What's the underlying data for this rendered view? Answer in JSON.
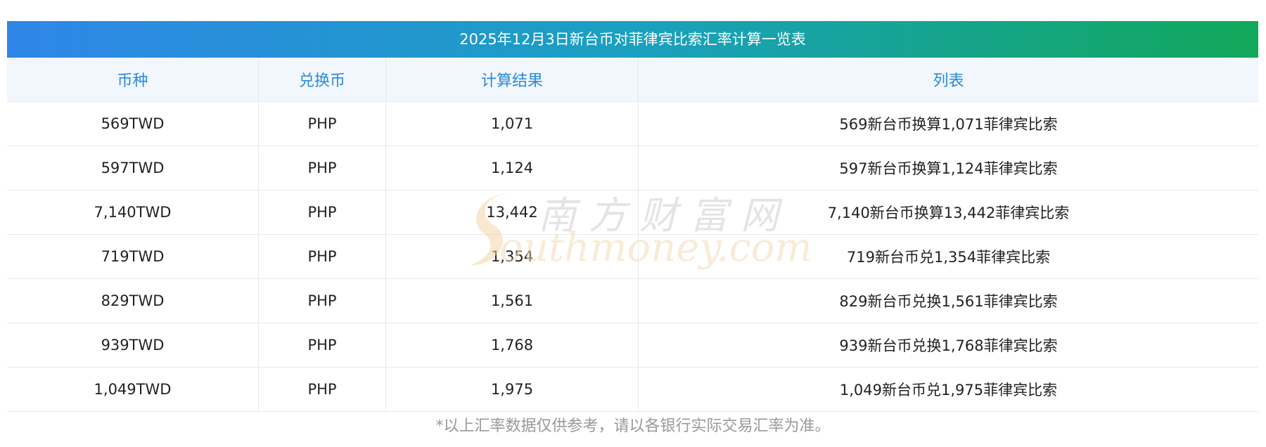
{
  "title": "2025年12月3日新台币对菲律宾比索汇率计算一览表",
  "headers": [
    "币种",
    "兑换币",
    "计算结果",
    "列表"
  ],
  "rows": [
    [
      "569TWD",
      "PHP",
      "1,071",
      "569新台币换算1,071菲律宾比索"
    ],
    [
      "597TWD",
      "PHP",
      "1,124",
      "597新台币换算1,124菲律宾比索"
    ],
    [
      "7,140TWD",
      "PHP",
      "13,442",
      "7,140新台币换算13,442菲律宾比索"
    ],
    [
      "719TWD",
      "PHP",
      "1,354",
      "719新台币兑1,354菲律宾比索"
    ],
    [
      "829TWD",
      "PHP",
      "1,561",
      "829新台币兑换1,561菲律宾比索"
    ],
    [
      "939TWD",
      "PHP",
      "1,768",
      "939新台币兑换1,768菲律宾比索"
    ],
    [
      "1,049TWD",
      "PHP",
      "1,975",
      "1,049新台币兑1,975菲律宾比索"
    ]
  ],
  "watermark": {
    "cn": "南方财富网",
    "en": "outhmoney.com"
  },
  "footnote": "*以上汇率数据仅供参考，请以各银行实际交易汇率为准。",
  "colors": {
    "header_text": "#2a8bd8",
    "header_bg": "#f2f7fd",
    "title_gradient_start": "#2f86e8",
    "title_gradient_end": "#11a85a"
  }
}
